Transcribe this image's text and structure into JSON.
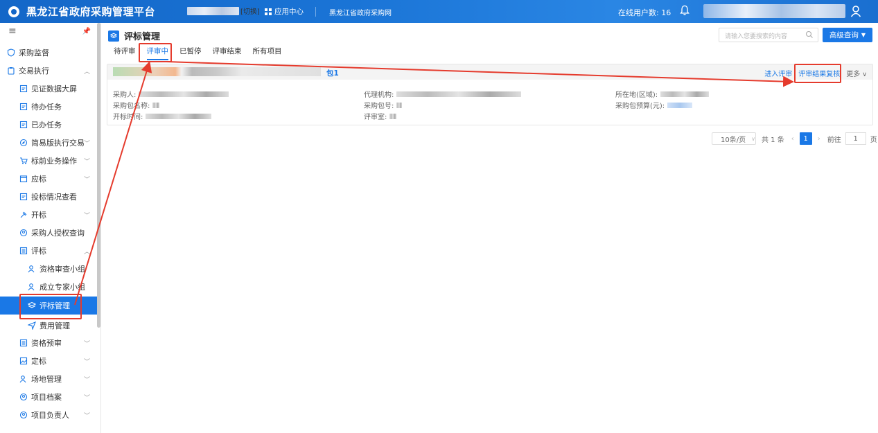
{
  "header": {
    "app_title": "黑龙江省政府采购管理平台",
    "switch_label": "[切换]",
    "app_center": "应用中心",
    "site_link": "黑龙江省政府采购网",
    "online_users_label": "在线用户数: 16"
  },
  "sidebar": {
    "items": [
      {
        "label": "采购监督"
      },
      {
        "label": "交易执行"
      },
      {
        "label": "见证数据大屏"
      },
      {
        "label": "待办任务"
      },
      {
        "label": "已办任务"
      },
      {
        "label": "简易版执行交易"
      },
      {
        "label": "标前业务操作"
      },
      {
        "label": "应标"
      },
      {
        "label": "投标情况查看"
      },
      {
        "label": "开标"
      },
      {
        "label": "采购人授权查询"
      },
      {
        "label": "评标"
      },
      {
        "label": "资格审查小组"
      },
      {
        "label": "成立专家小组"
      },
      {
        "label": "评标管理"
      },
      {
        "label": "费用管理"
      },
      {
        "label": "资格预审"
      },
      {
        "label": "定标"
      },
      {
        "label": "场地管理"
      },
      {
        "label": "项目档案"
      },
      {
        "label": "项目负责人"
      }
    ]
  },
  "main": {
    "title": "评标管理",
    "search_placeholder": "请输入您要搜索的内容",
    "advanced_query": "高级查询",
    "tabs": [
      {
        "label": "待评审"
      },
      {
        "label": "评审中"
      },
      {
        "label": "已暂停"
      },
      {
        "label": "评审结束"
      },
      {
        "label": "所有项目"
      }
    ],
    "card": {
      "package_label": "包1",
      "actions": {
        "enter": "进入评审",
        "review": "评审结果复核",
        "more": "更多"
      },
      "fields": {
        "purchaser": "采购人:",
        "agency": "代理机构:",
        "region": "所在地(区域):",
        "package_name": "采购包名称:",
        "package_no": "采购包号:",
        "budget": "采购包预算(元):",
        "open_time": "开标时间:",
        "room": "评审室:"
      }
    },
    "pager": {
      "page_size": "10条/页",
      "total": "共 1 条",
      "current_page": "1",
      "goto_label": "前往",
      "goto_value": "1",
      "page_suffix": "页"
    }
  },
  "colors": {
    "brand": "#1a78e6",
    "annotation": "#e53b2d"
  }
}
